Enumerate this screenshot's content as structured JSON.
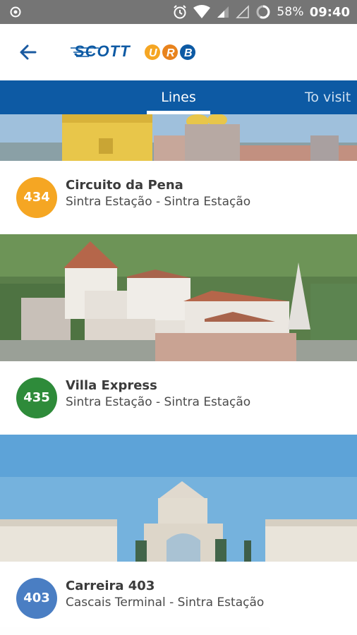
{
  "status_bar": {
    "battery": "58%",
    "time": "09:40",
    "icons": [
      "camera-dot-icon",
      "alarm-icon",
      "wifi-icon",
      "signal-icon",
      "signal-empty-icon",
      "battery-ring-icon"
    ]
  },
  "header": {
    "back_icon": "arrow-left-icon",
    "logo_text": "SCOTT URB",
    "logo_main": "SCOTT",
    "logo_letters": [
      "U",
      "R",
      "B"
    ]
  },
  "tabs": [
    {
      "label": "Lines",
      "selected": true
    },
    {
      "label": "To visit",
      "selected": false
    }
  ],
  "lines": [
    {
      "number": "434",
      "title": "Circuito da Pena",
      "route": "Sintra Estação - Sintra Estação",
      "color": "#f5a623"
    },
    {
      "number": "435",
      "title": "Villa Express",
      "route": "Sintra Estação - Sintra Estação",
      "color": "#2e8b3a"
    },
    {
      "number": "403",
      "title": "Carreira 403",
      "route": "Cascais Terminal - Sintra Estação",
      "color": "#4a7ec3"
    }
  ],
  "colors": {
    "tab_bar": "#0d5aa4",
    "status_bar": "#757575",
    "accent_orange": "#f5a623"
  }
}
